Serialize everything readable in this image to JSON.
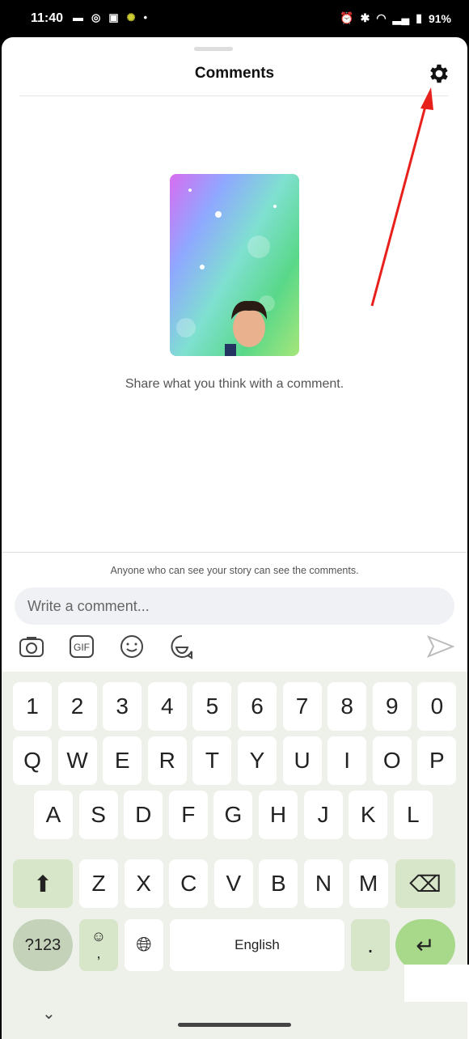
{
  "status_bar": {
    "time": "11:40",
    "battery": "91%",
    "left_icons": [
      "news-icon",
      "instagram-icon",
      "calendar-icon",
      "app-icon",
      "dot-icon"
    ],
    "right_icons": [
      "alarm-icon",
      "bluetooth-icon",
      "volte-icon",
      "wifi-icon",
      "signal-icon",
      "battery-icon"
    ]
  },
  "header": {
    "title": "Comments",
    "settings_icon": "gear-icon"
  },
  "empty_state": {
    "message": "Share what you think with a comment."
  },
  "composer": {
    "notice": "Anyone who can see your story can see the comments.",
    "placeholder": "Write a comment...",
    "value": "",
    "tools": [
      "camera-icon",
      "gif-icon",
      "emoji-icon",
      "sticker-icon"
    ],
    "send_icon": "send-icon"
  },
  "annotation": {
    "arrow_color": "#e8201c"
  },
  "keyboard": {
    "rows": [
      [
        "1",
        "2",
        "3",
        "4",
        "5",
        "6",
        "7",
        "8",
        "9",
        "0"
      ],
      [
        "Q",
        "W",
        "E",
        "R",
        "T",
        "Y",
        "U",
        "I",
        "O",
        "P"
      ],
      [
        "A",
        "S",
        "D",
        "F",
        "G",
        "H",
        "J",
        "K",
        "L"
      ],
      [
        "Z",
        "X",
        "C",
        "V",
        "B",
        "N",
        "M"
      ]
    ],
    "symbols_label": "?123",
    "space_label": "English",
    "period": ".",
    "comma": ",",
    "emoji_key": "☺",
    "accent": "#a8d88a"
  }
}
